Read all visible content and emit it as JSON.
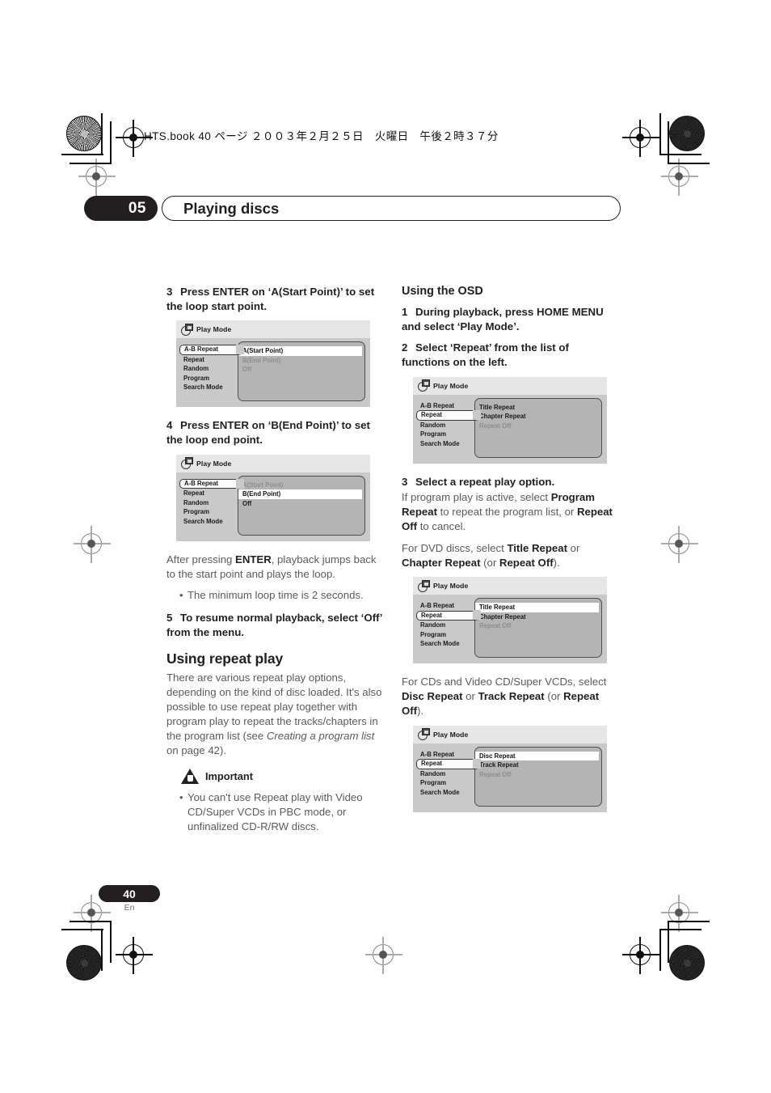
{
  "header": {
    "running_head": "HTS.book  40 ページ  ２００３年２月２５日　火曜日　午後２時３７分"
  },
  "chapter": {
    "number": "05",
    "title": "Playing discs"
  },
  "footer": {
    "page_number": "40",
    "language": "En"
  },
  "colors": {
    "ink": "#231f20",
    "body_text": "#5b5b5f",
    "osd_bg": "#c9c9c9",
    "osd_panel": "#b4b4b4",
    "osd_titlebar": "#e6e6e6",
    "highlight": "#ffffff",
    "dim_text": "#8e8e8e"
  },
  "left_column": {
    "step3": {
      "number": "3",
      "text": "Press ENTER on ‘A(Start Point)’ to set the loop start point."
    },
    "step4": {
      "number": "4",
      "text": "Press ENTER on ‘B(End Point)’ to set the loop end point."
    },
    "after_enter_para": {
      "before": "After pressing ",
      "bold": "ENTER",
      "after": ", playback jumps back to the start point and plays the loop."
    },
    "bullets": [
      "The minimum loop time is 2 seconds."
    ],
    "step5": {
      "number": "5",
      "text": "To resume normal playback, select ‘Off’ from the menu."
    },
    "repeat_section": {
      "heading": "Using repeat play",
      "para_a": "There are various repeat play options, depending on the kind of disc loaded. It's also possible to use repeat play together with program play to repeat the tracks/chapters in the program list (see ",
      "para_a_italic": "Creating a program list",
      "para_a_end": " on page 42).",
      "important_label": "Important",
      "important_bullets": [
        "You can't use Repeat play with Video CD/Super VCDs in PBC mode, or unfinalized CD-R/RW discs."
      ]
    }
  },
  "right_column": {
    "osd_section": {
      "heading": "Using the OSD",
      "step1": {
        "number": "1",
        "text": "During playback, press HOME MENU and select ‘Play Mode’."
      },
      "step2": {
        "number": "2",
        "text": "Select ‘Repeat’ from the list of functions on the left."
      },
      "step3": {
        "number": "3",
        "text": "Select a repeat play option."
      },
      "para_program": {
        "p1": "If program play is active, select ",
        "b1": "Program Repeat",
        "p2": " to repeat the program list, or ",
        "b2": "Repeat Off",
        "p3": " to cancel."
      },
      "para_dvd": {
        "p1": "For DVD discs, select ",
        "b1": "Title Repeat",
        "p2": " or ",
        "b2": "Chapter Repeat",
        "p3": " (or ",
        "b3": "Repeat Off",
        "p4": ")."
      },
      "para_cd": {
        "p1": "For CDs and Video CD/Super VCDs, select ",
        "b1": "Disc Repeat",
        "p2": " or ",
        "b2": "Track Repeat",
        "p3": " (or ",
        "b3": "Repeat Off",
        "p4": ")."
      }
    }
  },
  "osd_screens": [
    {
      "id": "osd-ab-start",
      "title": "Play Mode",
      "icon": "play-mode-icon",
      "menu": [
        {
          "label": "A-B Repeat",
          "selected": true
        },
        {
          "label": "Repeat",
          "selected": false
        },
        {
          "label": "Random",
          "selected": false
        },
        {
          "label": "Program",
          "selected": false
        },
        {
          "label": "Search Mode",
          "selected": false
        }
      ],
      "options": [
        {
          "label": "A(Start Point)",
          "state": "highlighted"
        },
        {
          "label": "B(End Point)",
          "state": "dimmed"
        },
        {
          "label": "Off",
          "state": "dimmed"
        }
      ]
    },
    {
      "id": "osd-ab-end",
      "title": "Play Mode",
      "icon": "play-mode-icon",
      "menu": [
        {
          "label": "A-B Repeat",
          "selected": true
        },
        {
          "label": "Repeat",
          "selected": false
        },
        {
          "label": "Random",
          "selected": false
        },
        {
          "label": "Program",
          "selected": false
        },
        {
          "label": "Search Mode",
          "selected": false
        }
      ],
      "options": [
        {
          "label": "A(Start Point)",
          "state": "dimmed"
        },
        {
          "label": "B(End Point)",
          "state": "highlighted"
        },
        {
          "label": "Off",
          "state": "normal"
        }
      ]
    },
    {
      "id": "osd-repeat-list",
      "title": "Play Mode",
      "icon": "play-mode-icon",
      "menu": [
        {
          "label": "A-B Repeat",
          "selected": false
        },
        {
          "label": "Repeat",
          "selected": true
        },
        {
          "label": "Random",
          "selected": false
        },
        {
          "label": "Program",
          "selected": false
        },
        {
          "label": "Search Mode",
          "selected": false
        }
      ],
      "options": [
        {
          "label": "Title Repeat",
          "state": "normal"
        },
        {
          "label": "Chapter Repeat",
          "state": "normal"
        },
        {
          "label": "Repeat Off",
          "state": "dimmed"
        }
      ]
    },
    {
      "id": "osd-title-repeat",
      "title": "Play Mode",
      "icon": "play-mode-icon",
      "menu": [
        {
          "label": "A-B Repeat",
          "selected": false
        },
        {
          "label": "Repeat",
          "selected": true
        },
        {
          "label": "Random",
          "selected": false
        },
        {
          "label": "Program",
          "selected": false
        },
        {
          "label": "Search Mode",
          "selected": false
        }
      ],
      "options": [
        {
          "label": "Title Repeat",
          "state": "highlighted"
        },
        {
          "label": "Chapter Repeat",
          "state": "normal"
        },
        {
          "label": "Repeat Off",
          "state": "dimmed"
        }
      ]
    },
    {
      "id": "osd-disc-repeat",
      "title": "Play Mode",
      "icon": "play-mode-icon",
      "menu": [
        {
          "label": "A-B Repeat",
          "selected": false
        },
        {
          "label": "Repeat",
          "selected": true
        },
        {
          "label": "Random",
          "selected": false
        },
        {
          "label": "Program",
          "selected": false
        },
        {
          "label": "Search Mode",
          "selected": false
        }
      ],
      "options": [
        {
          "label": "Disc Repeat",
          "state": "highlighted"
        },
        {
          "label": "Track Repeat",
          "state": "normal"
        },
        {
          "label": "Repeat Off",
          "state": "dimmed"
        }
      ]
    }
  ]
}
